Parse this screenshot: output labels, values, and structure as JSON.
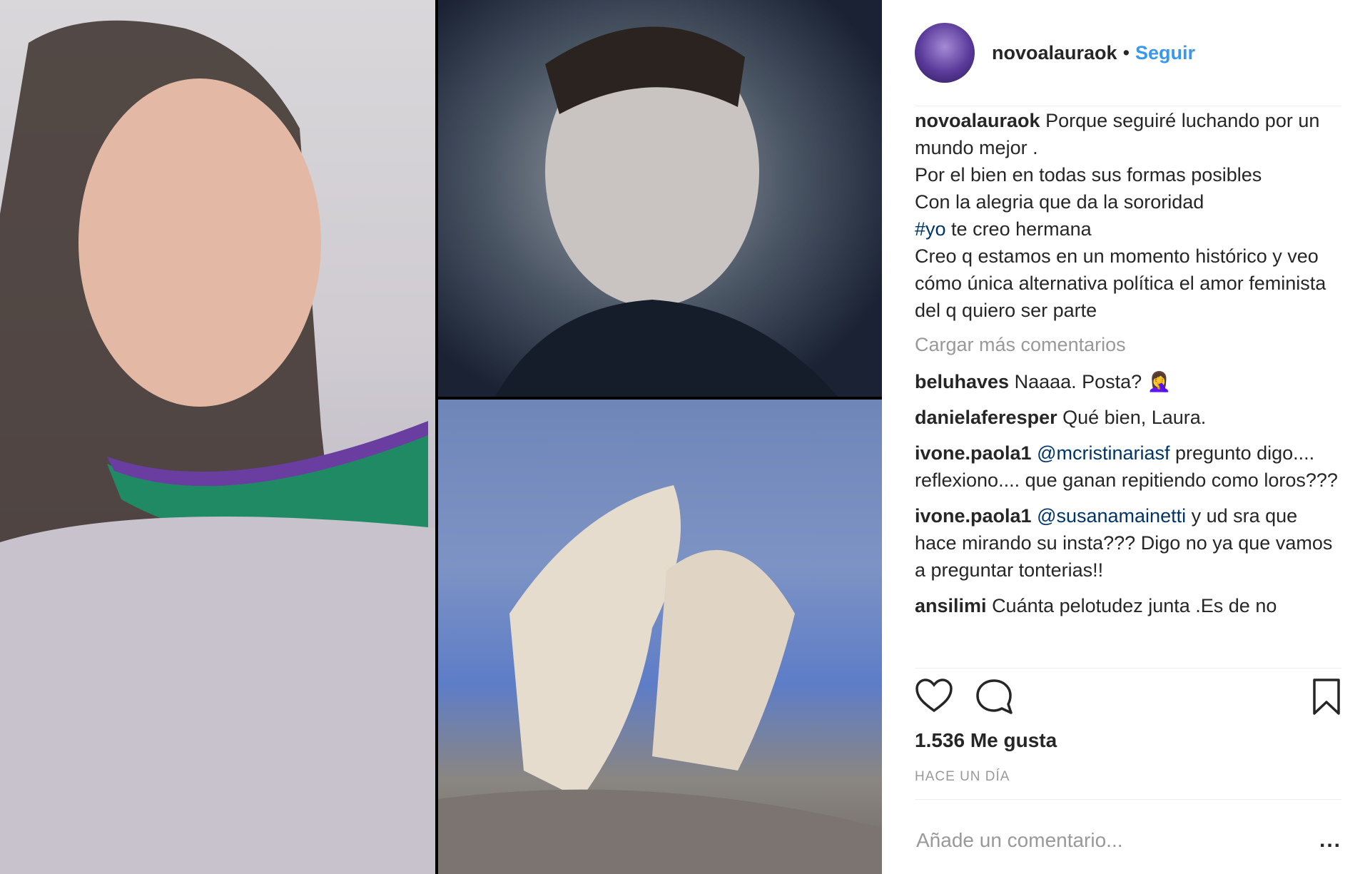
{
  "post": {
    "username": "novoalauraok",
    "follow_label": "Seguir",
    "caption": {
      "username": "novoalauraok",
      "line1": "Porque seguiré luchando por un mundo mejor .",
      "line2": "Por el bien en todas sus formas posibles",
      "line3": "Con la alegria que da la sororidad",
      "hashtag": "#yo",
      "line4_rest": " te creo hermana",
      "line5": "Creo q estamos en un momento histórico y veo cómo única alternativa política el amor feminista del q quiero ser parte"
    },
    "load_more_label": "Cargar más comentarios",
    "comments": [
      {
        "user": "beluhaves",
        "mention": "",
        "text": "Naaaa. Posta? 🤦‍♀️"
      },
      {
        "user": "danielaferesper",
        "mention": "",
        "text": "Qué bien, Laura."
      },
      {
        "user": "ivone.paola1",
        "mention": "@mcristinariasf",
        "text": " pregunto digo.... reflexiono.... que ganan repitiendo como loros???"
      },
      {
        "user": "ivone.paola1",
        "mention": "@susanamainetti",
        "text": " y ud sra que hace mirando su insta??? Digo no ya que vamos a preguntar tonterias!!"
      },
      {
        "user": "ansilimi",
        "mention": "",
        "text": "Cuánta pelotudez junta .Es de no"
      }
    ],
    "likes_label": "1.536 Me gusta",
    "timestamp": "HACE UN DÍA",
    "add_comment_placeholder": "Añade un comentario...",
    "more_label": "..."
  },
  "colors": {
    "link": "#3897f0",
    "hashtag": "#003569",
    "muted": "#999999",
    "text": "#262626"
  },
  "icons": [
    "heart-icon",
    "comment-bubble-icon",
    "bookmark-icon",
    "more-options-icon"
  ]
}
